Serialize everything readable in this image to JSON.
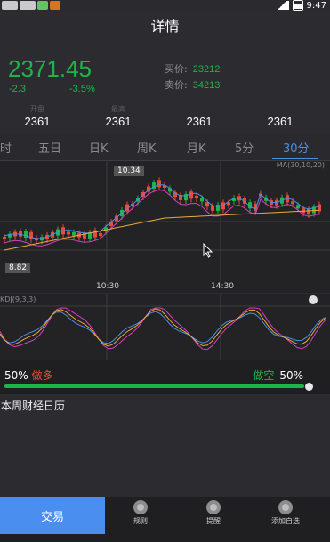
{
  "status_bar": {
    "time": "9:47",
    "icons": [
      "app-icon-1",
      "app-icon-2",
      "app-icon-3",
      "app-icon-4",
      "signal-icon",
      "battery-icon"
    ]
  },
  "header": {
    "title": "详情"
  },
  "quote": {
    "price": "2371.45",
    "change_abs": "-2.3",
    "change_pct": "-3.5%",
    "bid_label": "买价:",
    "bid_value": "23212",
    "ask_label": "卖价:",
    "ask_value": "34213"
  },
  "stats": [
    {
      "label": "开盘",
      "value": "2361"
    },
    {
      "label": "最高",
      "value": "2361"
    },
    {
      "label": "",
      "value": "2361"
    },
    {
      "label": "",
      "value": "2361"
    }
  ],
  "tabs": [
    {
      "label": "时"
    },
    {
      "label": "五日"
    },
    {
      "label": "日K"
    },
    {
      "label": "周K"
    },
    {
      "label": "月K"
    },
    {
      "label": "5分"
    },
    {
      "label": "30分",
      "active": true
    }
  ],
  "chart": {
    "ma_legend": "MA(30,10,20)",
    "high_label": "10.34",
    "low_label": "8.82",
    "time_labels": [
      "10:30",
      "14:30"
    ],
    "kdj_label": "KDJ(9,3,3)"
  },
  "ratio": {
    "left_pct": "50%",
    "left_tag": "做多",
    "right_tag": "做空",
    "right_pct": "50%"
  },
  "calendar": {
    "title": "本周财经日历"
  },
  "bottom_nav": {
    "trade": "交易",
    "items": [
      {
        "label": "规则",
        "icon": "rules-icon"
      },
      {
        "label": "提醒",
        "icon": "reminder-icon"
      },
      {
        "label": "添加自选",
        "icon": "add-favorite-icon"
      }
    ]
  },
  "colors": {
    "up": "#e24d3c",
    "down": "#1fb447",
    "accent": "#4a90e2",
    "trade_button": "#4a8fef"
  }
}
